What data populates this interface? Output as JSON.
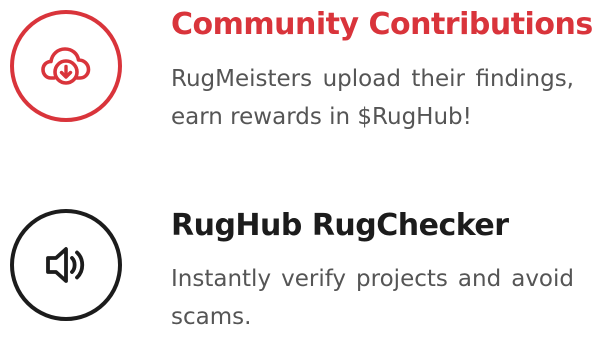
{
  "colors": {
    "accent": "#d9343b",
    "dark": "#1c1c1c",
    "body_text": "#555555",
    "background": "#ffffff"
  },
  "features": [
    {
      "icon": "cloud-download-icon",
      "title": "Community Contributions",
      "description": "RugMeisters upload their find­ings, earn rewards in $RugHub!"
    },
    {
      "icon": "speaker-volume-icon",
      "title": "RugHub RugChecker",
      "description": "Instantly verify projects and avoid scams."
    }
  ]
}
